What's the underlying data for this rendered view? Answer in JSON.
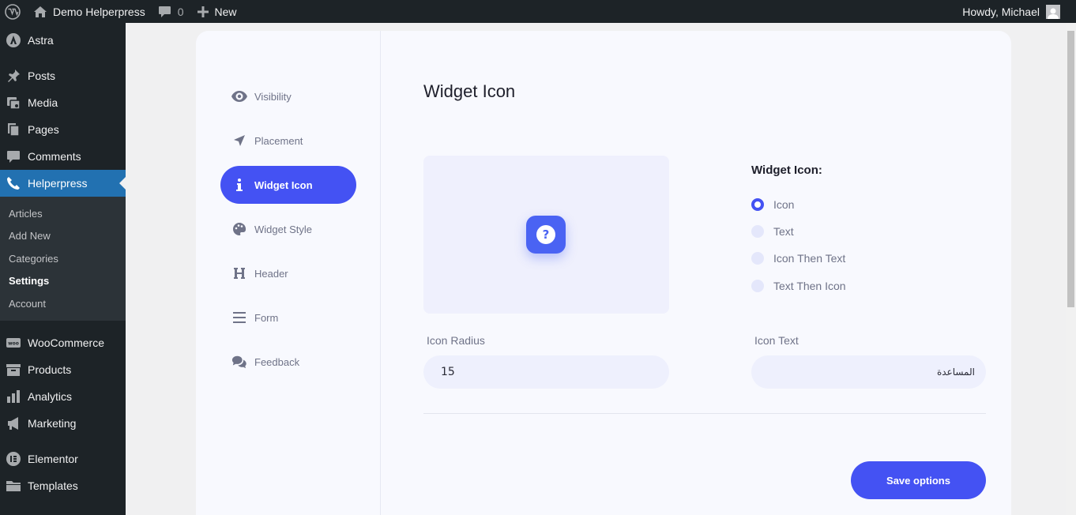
{
  "adminbar": {
    "site_name": "Demo Helperpress",
    "comments_count": "0",
    "new_label": "New",
    "howdy": "Howdy, Michael"
  },
  "sidebar": {
    "items": [
      {
        "label": "Astra",
        "icon": "astra-icon"
      },
      {
        "label": "Posts",
        "icon": "pin-icon"
      },
      {
        "label": "Media",
        "icon": "media-icon"
      },
      {
        "label": "Pages",
        "icon": "pages-icon"
      },
      {
        "label": "Comments",
        "icon": "comment-icon"
      },
      {
        "label": "Helperpress",
        "icon": "phone-icon"
      },
      {
        "label": "WooCommerce",
        "icon": "woo-icon"
      },
      {
        "label": "Products",
        "icon": "archive-icon"
      },
      {
        "label": "Analytics",
        "icon": "bar-chart-icon"
      },
      {
        "label": "Marketing",
        "icon": "megaphone-icon"
      },
      {
        "label": "Elementor",
        "icon": "elementor-icon"
      },
      {
        "label": "Templates",
        "icon": "folder-icon"
      }
    ],
    "submenu": [
      "Articles",
      "Add New",
      "Categories",
      "Settings",
      "Account"
    ]
  },
  "tabs": [
    {
      "label": "Visibility",
      "icon": "eye-icon"
    },
    {
      "label": "Placement",
      "icon": "location-arrow-icon"
    },
    {
      "label": "Widget Icon",
      "icon": "info-icon"
    },
    {
      "label": "Widget Style",
      "icon": "palette-icon"
    },
    {
      "label": "Header",
      "icon": "heading-icon"
    },
    {
      "label": "Form",
      "icon": "bars-icon"
    },
    {
      "label": "Feedback",
      "icon": "comments-icon"
    }
  ],
  "panel": {
    "title": "Widget Icon",
    "option_label": "Widget Icon:",
    "options": [
      "Icon",
      "Text",
      "Icon Then Text",
      "Text Then Icon"
    ],
    "selected_option": "Icon",
    "icon_radius_label": "Icon Radius",
    "icon_radius_value": "15",
    "icon_text_label": "Icon Text",
    "icon_text_value": "المساعدة",
    "save_label": "Save options"
  },
  "colors": {
    "accent": "#4452f3",
    "wp_admin_dark": "#1d2327",
    "wp_active_blue": "#2271b1",
    "widget_button": "#4a63f3"
  }
}
